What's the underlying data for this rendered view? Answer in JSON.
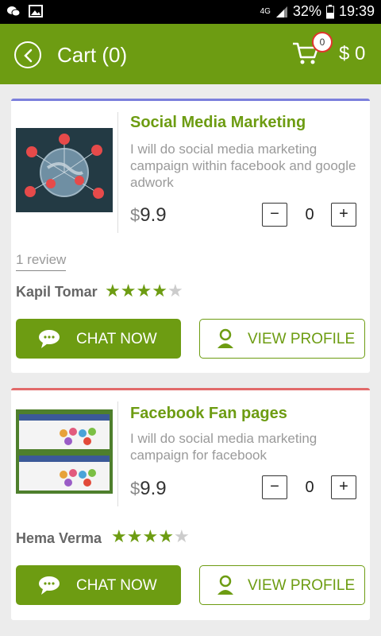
{
  "status_bar": {
    "battery": "32%",
    "time": "19:39",
    "network": "4G"
  },
  "app_bar": {
    "title": "Cart (0)",
    "cart_count": "0",
    "cart_total": "$ 0"
  },
  "colors": {
    "brand": "#6d9c12",
    "card1_accent": "#7b7fdc",
    "card2_accent": "#e26a6a"
  },
  "items": [
    {
      "title": "Social Media Marketing",
      "description": "I will do social media marketing campaign within facebook and google adwork",
      "currency": "$",
      "price": "9.9",
      "quantity": "0",
      "review_text": "1 review",
      "seller": "Kapil Tomar",
      "rating": 4,
      "chat_label": "CHAT NOW",
      "profile_label": "VIEW PROFILE",
      "thumb_icon": "social-network-globe"
    },
    {
      "title": "Facebook Fan pages",
      "description": "I will do social media marketing campaign for facebook",
      "currency": "$",
      "price": "9.9",
      "quantity": "0",
      "seller": "Hema Verma",
      "rating": 4,
      "chat_label": "CHAT NOW",
      "profile_label": "VIEW PROFILE",
      "thumb_icon": "facebook-fan-page-preview"
    }
  ]
}
